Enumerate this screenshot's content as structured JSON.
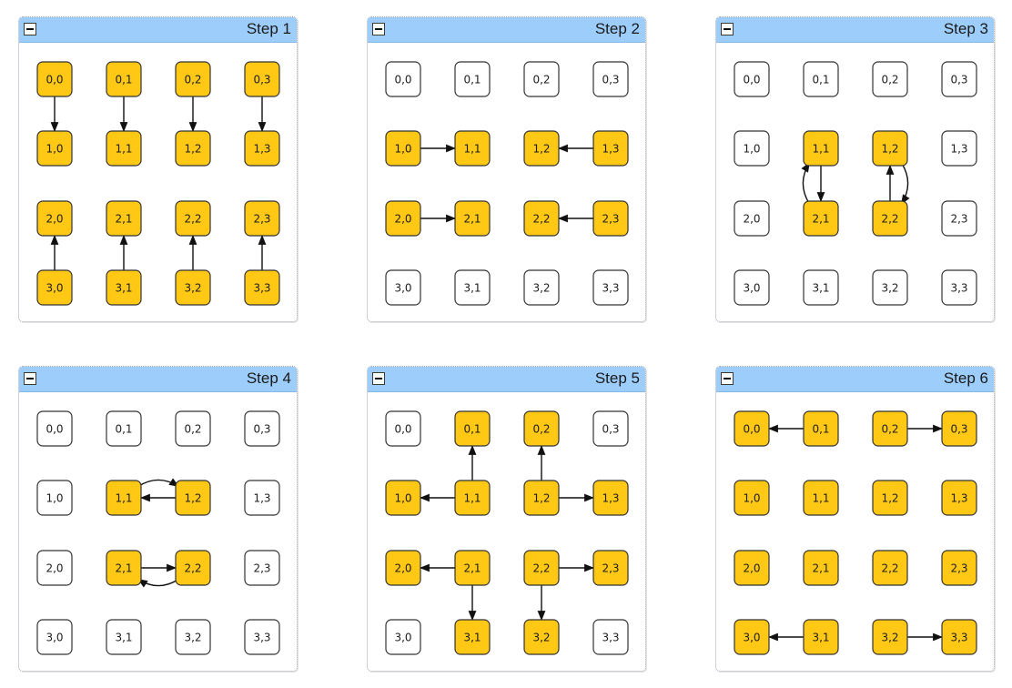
{
  "panels": [
    {
      "title": "Step 1",
      "active": [
        "0,0",
        "0,1",
        "0,2",
        "0,3",
        "1,0",
        "1,1",
        "1,2",
        "1,3",
        "2,0",
        "2,1",
        "2,2",
        "2,3",
        "3,0",
        "3,1",
        "3,2",
        "3,3"
      ],
      "edges": [
        {
          "from": "0,0",
          "to": "1,0"
        },
        {
          "from": "0,1",
          "to": "1,1"
        },
        {
          "from": "0,2",
          "to": "1,2"
        },
        {
          "from": "0,3",
          "to": "1,3"
        },
        {
          "from": "3,0",
          "to": "2,0"
        },
        {
          "from": "3,1",
          "to": "2,1"
        },
        {
          "from": "3,2",
          "to": "2,2"
        },
        {
          "from": "3,3",
          "to": "2,3"
        }
      ]
    },
    {
      "title": "Step 2",
      "active": [
        "1,0",
        "1,1",
        "1,2",
        "1,3",
        "2,0",
        "2,1",
        "2,2",
        "2,3"
      ],
      "edges": [
        {
          "from": "1,0",
          "to": "1,1"
        },
        {
          "from": "1,3",
          "to": "1,2"
        },
        {
          "from": "2,0",
          "to": "2,1"
        },
        {
          "from": "2,3",
          "to": "2,2"
        }
      ]
    },
    {
      "title": "Step 3",
      "active": [
        "1,1",
        "1,2",
        "2,1",
        "2,2"
      ],
      "edges": [
        {
          "from": "1,1",
          "to": "2,1"
        },
        {
          "from": "2,1",
          "to": "1,1",
          "curve": -1
        },
        {
          "from": "2,2",
          "to": "1,2"
        },
        {
          "from": "1,2",
          "to": "2,2",
          "curve": -1
        }
      ]
    },
    {
      "title": "Step 4",
      "active": [
        "1,1",
        "1,2",
        "2,1",
        "2,2"
      ],
      "edges": [
        {
          "from": "1,2",
          "to": "1,1"
        },
        {
          "from": "1,1",
          "to": "1,2",
          "curve": -1
        },
        {
          "from": "2,1",
          "to": "2,2"
        },
        {
          "from": "2,2",
          "to": "2,1",
          "curve": -1
        }
      ]
    },
    {
      "title": "Step 5",
      "active": [
        "0,1",
        "0,2",
        "1,0",
        "1,1",
        "1,2",
        "1,3",
        "2,0",
        "2,1",
        "2,2",
        "2,3",
        "3,1",
        "3,2"
      ],
      "edges": [
        {
          "from": "1,1",
          "to": "0,1"
        },
        {
          "from": "1,1",
          "to": "1,0"
        },
        {
          "from": "1,2",
          "to": "0,2"
        },
        {
          "from": "1,2",
          "to": "1,3"
        },
        {
          "from": "2,1",
          "to": "2,0"
        },
        {
          "from": "2,1",
          "to": "3,1"
        },
        {
          "from": "2,2",
          "to": "2,3"
        },
        {
          "from": "2,2",
          "to": "3,2"
        }
      ]
    },
    {
      "title": "Step 6",
      "active": [
        "0,0",
        "0,1",
        "0,2",
        "0,3",
        "1,0",
        "1,1",
        "1,2",
        "1,3",
        "2,0",
        "2,1",
        "2,2",
        "2,3",
        "3,0",
        "3,1",
        "3,2",
        "3,3"
      ],
      "edges": [
        {
          "from": "0,1",
          "to": "0,0"
        },
        {
          "from": "0,2",
          "to": "0,3"
        },
        {
          "from": "3,1",
          "to": "3,0"
        },
        {
          "from": "3,2",
          "to": "3,3"
        }
      ]
    }
  ],
  "node_labels": [
    "0,0",
    "0,1",
    "0,2",
    "0,3",
    "1,0",
    "1,1",
    "1,2",
    "1,3",
    "2,0",
    "2,1",
    "2,2",
    "2,3",
    "3,0",
    "3,1",
    "3,2",
    "3,3"
  ],
  "colors": {
    "active_fill": "#fec815",
    "inactive_fill": "#ffffff",
    "header": "#9dcdfb",
    "edge": "#111111"
  }
}
